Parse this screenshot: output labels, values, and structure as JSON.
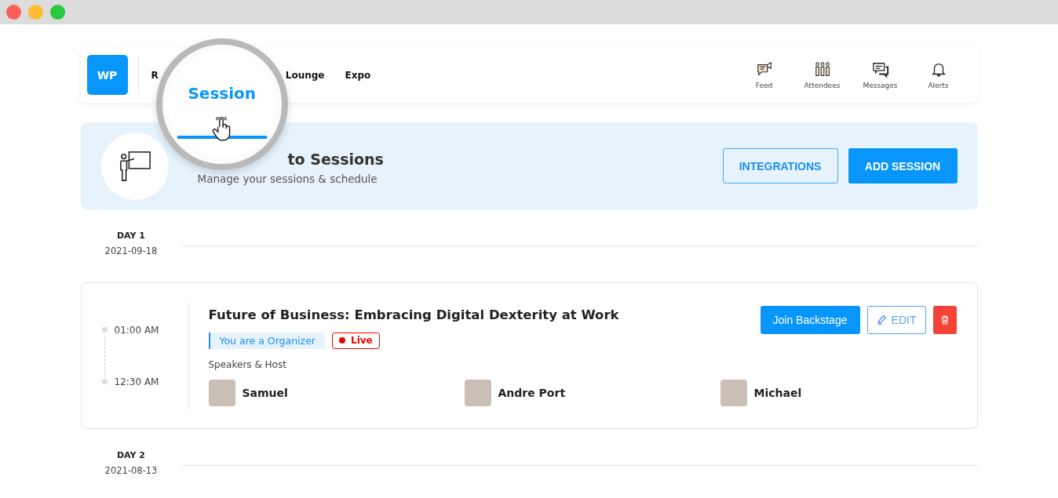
{
  "header": {
    "logo": "WP",
    "nav": [
      {
        "label": "R",
        "selected": false
      },
      {
        "label": "Session",
        "selected": true
      },
      {
        "label": "Lounge",
        "selected": false
      },
      {
        "label": "Expo",
        "selected": false
      }
    ],
    "actions": [
      {
        "kind": "feed",
        "label": "Feed"
      },
      {
        "kind": "attendees",
        "label": "Attendees"
      },
      {
        "kind": "messages",
        "label": "Messages"
      },
      {
        "kind": "alerts",
        "label": "Alerts"
      }
    ]
  },
  "banner": {
    "title": "to Sessions",
    "subtitle": "Manage your sessions & schedule",
    "buttons": [
      {
        "kind": "outline",
        "label": "INTEGRATIONS"
      },
      {
        "kind": "primary",
        "label": "ADD SESSION"
      }
    ]
  },
  "days": [
    {
      "day": "DAY 1",
      "date": "2021-09-18",
      "sessions": [
        {
          "start": "01:00 AM",
          "end": "12:30 AM",
          "title": "Future of Business: Embracing Digital Dexterity at Work",
          "role": "You are a Organizer",
          "live": true,
          "live_label": "Live",
          "speakers_label": "Speakers & Host",
          "speakers": [
            "Samuel",
            "Andre Port",
            "Michael"
          ],
          "join_label": "Join Backstage",
          "edit_label": "EDIT"
        }
      ]
    },
    {
      "day": "DAY 2",
      "date": "2021-08-13"
    }
  ]
}
